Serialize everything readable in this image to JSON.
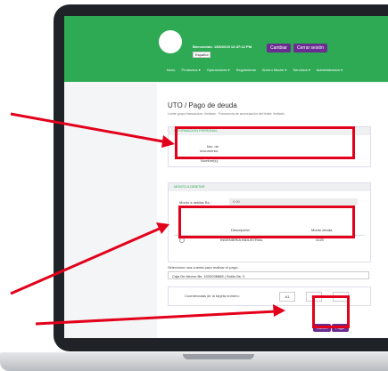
{
  "header": {
    "welcome_text": "Bienvenido: 15/6/2019 12:37:12 PM",
    "language_selected": "Español",
    "change_button": "Cambiar",
    "logout_button": "Cerrar sesión"
  },
  "menu": {
    "items": [
      "Inicio",
      "Productos ▾",
      "Operaciones ▾",
      "Seguimiento",
      "Ahorro Madre ▾",
      "Servicios ▾",
      "Administración ▾"
    ]
  },
  "page": {
    "breadcrumb": "UTO / Pago de deuda",
    "limit_info": "Límite grupo transacción: limitado  ·  Frecuencia de acumulación del límite: limitado"
  },
  "personal_info": {
    "title": "INFORMACIÓN PERSONAL",
    "doc_label": "Nro. de documento:",
    "name_label": "Nombre(s):"
  },
  "debt": {
    "title": "MONTO A DEBITAR",
    "amount_label": "Monto a debitar Bs.:",
    "amount_value": "0.00",
    "table": {
      "headers": [
        "Descripción",
        "Monto deuda"
      ],
      "rows": [
        {
          "description": "INGENIERIA INDUSTRIAL",
          "amount": "4120"
        }
      ]
    }
  },
  "payment": {
    "account_label": "Seleccione una cuenta para realizar el pago:",
    "account_value": "Caja De Ahorro Bs. 1020036868 | Saldo Bs. 0"
  },
  "coordinates": {
    "label": "Coordenadas de la tarjeta número:",
    "values": [
      "A1",
      "B1",
      "C3"
    ]
  },
  "actions": {
    "cancel": "Cancel",
    "pay": "Pagar"
  },
  "colors": {
    "header_green": "#2eaa55",
    "accent_purple": "#6b2c91",
    "annotation_red": "#e3001b"
  }
}
